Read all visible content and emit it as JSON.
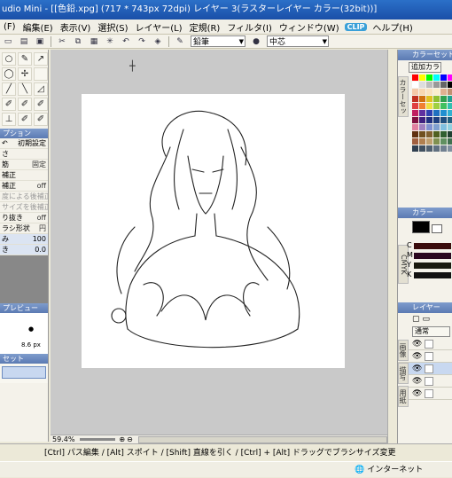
{
  "window": {
    "title": "udio Mini - [[色鉛.xpg] (717 * 743px 72dpi)   レイヤー 3(ラスターレイヤー カラー(32bit))]"
  },
  "menu": {
    "items": [
      "(F)",
      "編集(E)",
      "表示(V)",
      "選択(S)",
      "レイヤー(L)",
      "定規(R)",
      "フィルタ(I)",
      "ウィンドウ(W)",
      "ヘルプ(H)"
    ],
    "badge": "CLIP"
  },
  "toolbar": {
    "brush_name": "鉛筆",
    "align": "中芯"
  },
  "tools": {
    "icons": [
      "○",
      "✎",
      "↗",
      "◯",
      "✢",
      " ",
      "╱",
      "╲",
      "◿",
      "✐",
      "✐",
      "✐",
      "⊥",
      "✐",
      "✐"
    ]
  },
  "options": {
    "header": "プション",
    "reset_label": "初期設定",
    "rows": [
      {
        "label": "さ",
        "value": "",
        "disabled": false
      },
      {
        "label": "筋",
        "value": "固定",
        "disabled": false
      },
      {
        "label": "補正",
        "value": "",
        "disabled": false
      },
      {
        "label": "補正",
        "value": "off",
        "disabled": false
      },
      {
        "label": "度による後補正",
        "value": "",
        "disabled": true
      },
      {
        "label": "サイズを後補正",
        "value": "off",
        "disabled": true
      },
      {
        "label": "り抜き",
        "value": "off",
        "disabled": false
      }
    ],
    "brush_shape_label": "ラシ形状",
    "brush_shape_value": "円",
    "sliders": [
      {
        "label": "み",
        "value": "100"
      },
      {
        "label": "き",
        "value": "0.0"
      }
    ]
  },
  "preview": {
    "header": "プレビュー",
    "size": "8.6 px"
  },
  "preset": {
    "header": "セット"
  },
  "canvas": {
    "zoom": "59.4%"
  },
  "right": {
    "color_set_header": "カラーセット",
    "add_color_label": "追加カラーセ",
    "color_set_tab": "カラーセット",
    "color_header": "カラー",
    "cmyk_tab": "CMYK",
    "channels": [
      "C",
      "M",
      "Y",
      "K"
    ],
    "layer_header": "レイヤー",
    "blend_mode": "通常",
    "layer_tabs": [
      "画像",
      "描写",
      "用紙"
    ]
  },
  "status": {
    "hint": "[Ctrl] パス編集 / [Alt] スポイト / [Shift] 直線を引く / [Ctrl] + [Alt] ドラッグでブラシサイズ変更"
  },
  "taskbar": {
    "zone": "インターネット"
  },
  "swatch_colors": [
    "#ff0000",
    "#ffff00",
    "#00ff00",
    "#00ffff",
    "#0000ff",
    "#ff00ff",
    "#ffffff",
    "#dddddd",
    "#bbbbbb",
    "#999999",
    "#666666",
    "#000000",
    "#f4c9a8",
    "#f7d7b2",
    "#f9e2bf",
    "#fbeecc",
    "#e0b090",
    "#c09070",
    "#c03020",
    "#d07010",
    "#e0c020",
    "#90c030",
    "#30a050",
    "#20a090",
    "#e04040",
    "#f08030",
    "#f0e040",
    "#a0d040",
    "#40c060",
    "#30c0b0",
    "#c02060",
    "#6030a0",
    "#3040b0",
    "#2070c0",
    "#2090d0",
    "#30b0d0",
    "#801040",
    "#402080",
    "#203080",
    "#204080",
    "#205080",
    "#206080",
    "#e080a0",
    "#a080c0",
    "#8090d0",
    "#80a0d0",
    "#80c0e0",
    "#90d0e0",
    "#603010",
    "#705020",
    "#806030",
    "#506020",
    "#306030",
    "#204030",
    "#a06040",
    "#b08050",
    "#c0a070",
    "#809050",
    "#609060",
    "#407050",
    "#304050",
    "#405060",
    "#506070",
    "#607080",
    "#708090",
    "#8090a0"
  ]
}
